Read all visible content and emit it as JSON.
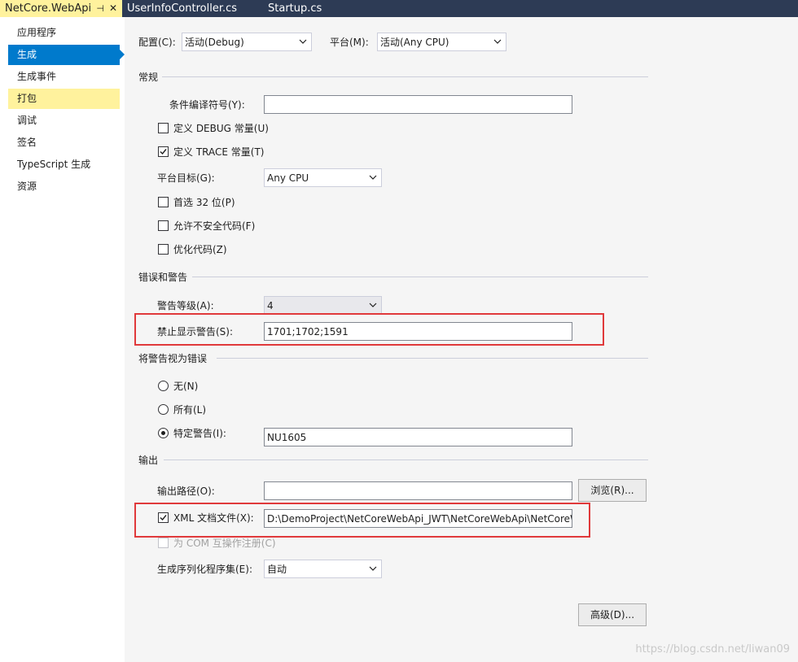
{
  "tabs": [
    {
      "label": "NetCore.WebApi",
      "active": true,
      "pin": "⊣",
      "close": "✕"
    },
    {
      "label": "UserInfoController.cs",
      "active": false
    },
    {
      "label": "Startup.cs",
      "active": false
    }
  ],
  "sidebar": {
    "items": [
      {
        "label": "应用程序"
      },
      {
        "label": "生成",
        "selected": true
      },
      {
        "label": "生成事件"
      },
      {
        "label": "打包",
        "hover": true
      },
      {
        "label": "调试"
      },
      {
        "label": "签名"
      },
      {
        "label": "TypeScript 生成"
      },
      {
        "label": "资源"
      }
    ]
  },
  "top": {
    "config_label": "配置(C):",
    "config_value": "活动(Debug)",
    "platform_label": "平台(M):",
    "platform_value": "活动(Any CPU)"
  },
  "general": {
    "title": "常规",
    "symbols_label": "条件编译符号(Y):",
    "symbols_value": "",
    "debug_label": "定义 DEBUG 常量(U)",
    "debug_checked": false,
    "trace_label": "定义 TRACE 常量(T)",
    "trace_checked": true,
    "target_label": "平台目标(G):",
    "target_value": "Any CPU",
    "prefer32_label": "首选 32 位(P)",
    "unsafe_label": "允许不安全代码(F)",
    "optimize_label": "优化代码(Z)"
  },
  "errors": {
    "title": "错误和警告",
    "level_label": "警告等级(A):",
    "level_value": "4",
    "suppress_label": "禁止显示警告(S):",
    "suppress_value": "1701;1702;1591"
  },
  "treat": {
    "title": "将警告视为错误",
    "none_label": "无(N)",
    "all_label": "所有(L)",
    "specific_label": "特定警告(I):",
    "specific_value": "NU1605",
    "selected": "specific"
  },
  "output": {
    "title": "输出",
    "path_label": "输出路径(O):",
    "path_value": "",
    "browse_label": "浏览(R)...",
    "xml_label": "XML 文档文件(X):",
    "xml_checked": true,
    "xml_value": "D:\\DemoProject\\NetCoreWebApi_JWT\\NetCoreWebApi\\NetCoreWebApi.xml",
    "com_label": "为 COM 互操作注册(C)",
    "serial_label": "生成序列化程序集(E):",
    "serial_value": "自动",
    "advanced_label": "高级(D)..."
  },
  "watermark": "https://blog.csdn.net/liwan09",
  "colors": {
    "accent": "#007acc",
    "tab_bar": "#2d3b55",
    "active_tab": "#fff29d",
    "highlight_box": "#e0393b"
  }
}
